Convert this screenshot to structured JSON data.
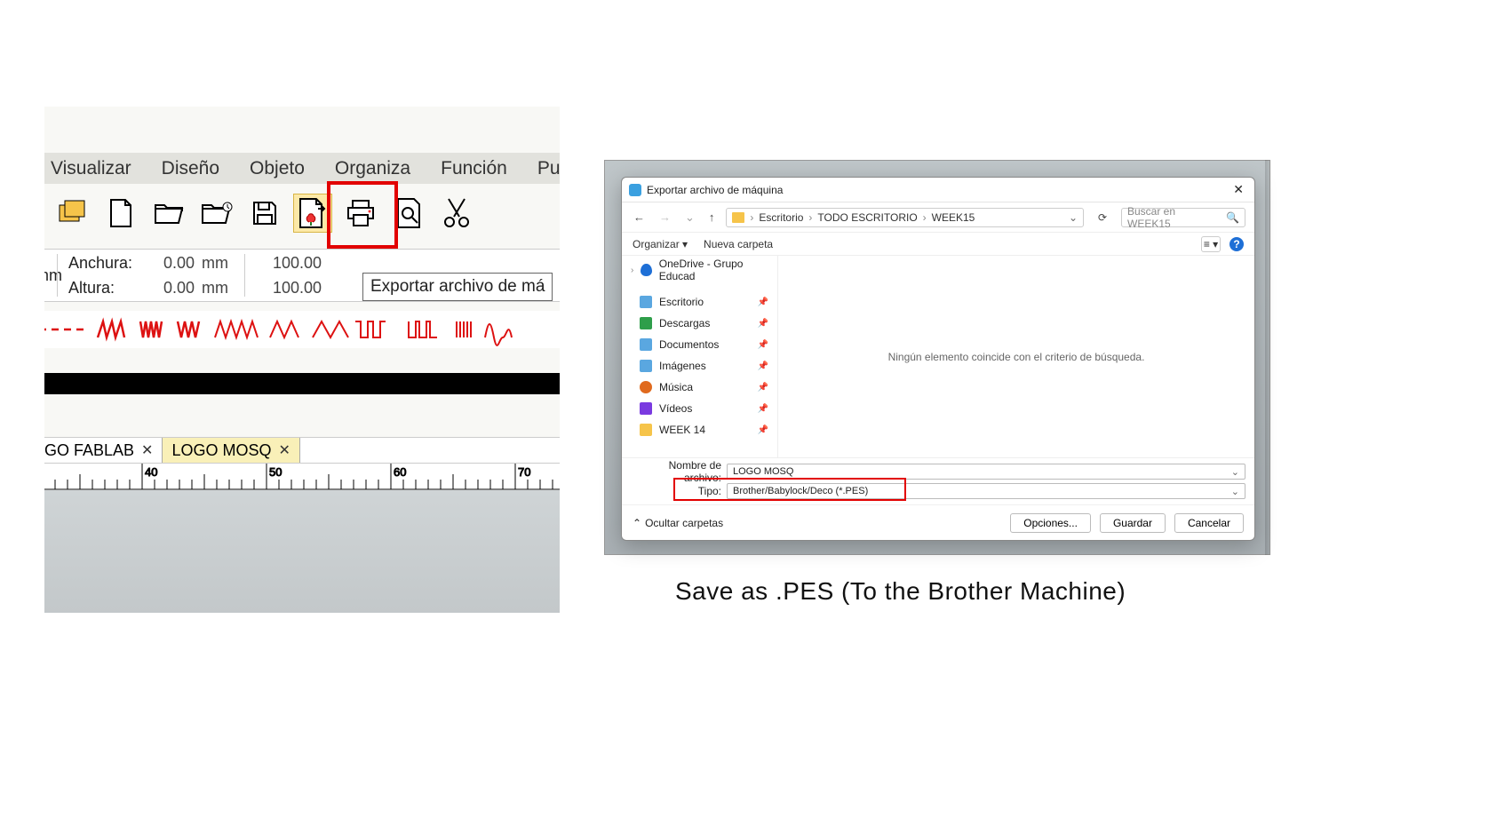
{
  "left": {
    "menu": [
      "Visualizar",
      "Diseño",
      "Objeto",
      "Organiza",
      "Función",
      "Pur"
    ],
    "tooltip": "Exportar archivo de má",
    "anchura_label": "Anchura:",
    "altura_label": "Altura:",
    "anchura_val": "0.00",
    "altura_val": "0.00",
    "unit": "mm",
    "anchura2": "100.00",
    "altura2": "100.00",
    "tabs": [
      {
        "label": "GO FABLAB",
        "active": false
      },
      {
        "label": "LOGO MOSQ",
        "active": true
      }
    ],
    "ruler": [
      "40",
      "50",
      "60",
      "70"
    ]
  },
  "dialog": {
    "title": "Exportar archivo de máquina",
    "breadcrumb": [
      "Escritorio",
      "TODO ESCRITORIO",
      "WEEK15"
    ],
    "search_placeholder": "Buscar en WEEK15",
    "organize": "Organizar",
    "new_folder": "Nueva carpeta",
    "onedrive": "OneDrive - Grupo Educad",
    "sidebar": [
      {
        "icon": "desktop",
        "label": "Escritorio"
      },
      {
        "icon": "download",
        "label": "Descargas"
      },
      {
        "icon": "doc",
        "label": "Documentos"
      },
      {
        "icon": "img",
        "label": "Imágenes"
      },
      {
        "icon": "music",
        "label": "Música"
      },
      {
        "icon": "video",
        "label": "Vídeos"
      },
      {
        "icon": "folder",
        "label": "WEEK 14"
      }
    ],
    "empty_text": "Ningún elemento coincide con el criterio de búsqueda.",
    "filename_label": "Nombre de archivo:",
    "filename_value": "LOGO MOSQ",
    "type_label": "Tipo:",
    "type_value": "Brother/Babylock/Deco (*.PES)",
    "hide_folders": "Ocultar carpetas",
    "options_btn": "Opciones...",
    "save_btn": "Guardar",
    "cancel_btn": "Cancelar"
  },
  "caption": "Save as .PES (To the Brother Machine)"
}
